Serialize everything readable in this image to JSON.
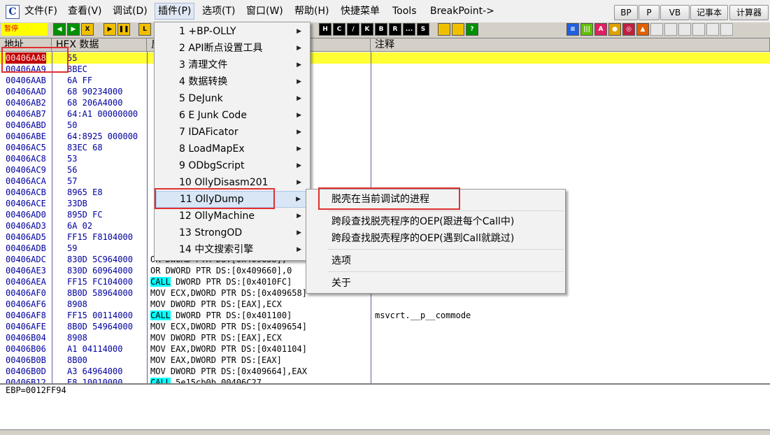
{
  "menubar": {
    "items": [
      "文件(F)",
      "查看(V)",
      "调试(D)",
      "插件(P)",
      "选项(T)",
      "窗口(W)",
      "帮助(H)",
      "快捷菜单",
      "Tools",
      "BreakPoint->"
    ],
    "active_index": 3,
    "quick_buttons": [
      "BP",
      "P",
      "VB",
      "记事本",
      "计算器"
    ]
  },
  "toolbar": {
    "status": "暂停",
    "left_buttons": [
      "◀",
      "▶",
      "X",
      "▶",
      "❚❚",
      "L"
    ],
    "letter_buttons": [
      "H",
      "C",
      "/",
      "K",
      "B",
      "R",
      "...",
      "S"
    ],
    "right_buttons": [
      "≡",
      "|||",
      "A",
      "●",
      "◎",
      "▲"
    ]
  },
  "columns": {
    "addr": "地址",
    "hex": "HEX 数据",
    "dis": "反汇编",
    "comment": "注释"
  },
  "rows": [
    {
      "addr": "00406AA8",
      "hex": "55",
      "dis": "",
      "com": ""
    },
    {
      "addr": "00406AA9",
      "hex": "8BEC",
      "dis": "",
      "com": ""
    },
    {
      "addr": "00406AAB",
      "hex": "6A FF",
      "dis": "",
      "com": ""
    },
    {
      "addr": "00406AAD",
      "hex": "68 90234000",
      "dis": "",
      "com": ""
    },
    {
      "addr": "00406AB2",
      "hex": "68 206A4000",
      "dis": "",
      "com": ""
    },
    {
      "addr": "00406AB7",
      "hex": "64:A1 00000000",
      "dis": "",
      "com": ""
    },
    {
      "addr": "00406ABD",
      "hex": "50",
      "dis": "",
      "com": ""
    },
    {
      "addr": "00406ABE",
      "hex": "64:8925 000000",
      "dis": "",
      "com": ""
    },
    {
      "addr": "00406AC5",
      "hex": "83EC 68",
      "dis": "",
      "com": ""
    },
    {
      "addr": "00406AC8",
      "hex": "53",
      "dis": "",
      "com": ""
    },
    {
      "addr": "00406AC9",
      "hex": "56",
      "dis": "",
      "com": ""
    },
    {
      "addr": "00406ACA",
      "hex": "57",
      "dis": "",
      "com": ""
    },
    {
      "addr": "00406ACB",
      "hex": "8965 E8",
      "dis": "",
      "com": ""
    },
    {
      "addr": "00406ACE",
      "hex": "33DB",
      "dis": "",
      "com": ""
    },
    {
      "addr": "00406AD0",
      "hex": "895D FC",
      "dis": "",
      "com": ""
    },
    {
      "addr": "00406AD3",
      "hex": "6A 02",
      "dis": "",
      "com": ""
    },
    {
      "addr": "00406AD5",
      "hex": "FF15 F8104000",
      "dis": "",
      "com": ""
    },
    {
      "addr": "00406ADB",
      "hex": "59",
      "dis": "",
      "com": ""
    },
    {
      "addr": "00406ADC",
      "hex": "830D 5C964000",
      "dis": "OR DWORD PTR DS:[0x409658],",
      "com": ""
    },
    {
      "addr": "00406AE3",
      "hex": "830D 60964000",
      "dis": "OR DWORD PTR DS:[0x409660],0",
      "com": ""
    },
    {
      "addr": "00406AEA",
      "hex": "FF15 FC104000",
      "call": "CALL",
      "dis": " DWORD PTR DS:[0x4010FC]",
      "com": ""
    },
    {
      "addr": "00406AF0",
      "hex": "8B0D 58964000",
      "dis": "MOV ECX,DWORD PTR DS:[0x409658]",
      "com": ""
    },
    {
      "addr": "00406AF6",
      "hex": "8908",
      "dis": "MOV DWORD PTR DS:[EAX],ECX",
      "com": ""
    },
    {
      "addr": "00406AF8",
      "hex": "FF15 00114000",
      "call": "CALL",
      "dis": " DWORD PTR DS:[0x401100]",
      "com": "msvcrt.__p__commode"
    },
    {
      "addr": "00406AFE",
      "hex": "8B0D 54964000",
      "dis": "MOV ECX,DWORD PTR DS:[0x409654]",
      "com": ""
    },
    {
      "addr": "00406B04",
      "hex": "8908",
      "dis": "MOV DWORD PTR DS:[EAX],ECX",
      "com": ""
    },
    {
      "addr": "00406B06",
      "hex": "A1 04114000",
      "dis": "MOV EAX,DWORD PTR DS:[0x401104]",
      "com": ""
    },
    {
      "addr": "00406B0B",
      "hex": "8B00",
      "dis": "MOV EAX,DWORD PTR DS:[EAX]",
      "com": ""
    },
    {
      "addr": "00406B0D",
      "hex": "A3 64964000",
      "dis": "MOV DWORD PTR DS:[0x409664],EAX",
      "com": ""
    },
    {
      "addr": "00406B12",
      "hex": "E8 10010000",
      "call": "CALL",
      "dis": " 5e15cb0b.00406C27",
      "com": ""
    }
  ],
  "info": {
    "text": "EBP=0012FF94"
  },
  "plugin_menu": {
    "items": [
      "1 +BP-OLLY",
      "2 API断点设置工具",
      "3 清理文件",
      "4 数据转换",
      "5 DeJunk",
      "6 E Junk Code",
      "7 IDAFicator",
      "8 LoadMapEx",
      "9 ODbgScript",
      "10 OllyDisasm201",
      "11 OllyDump",
      "12 OllyMachine",
      "13 StrongOD",
      "14 中文搜索引擎"
    ],
    "highlight_index": 10
  },
  "submenu": {
    "items": [
      "脱壳在当前调试的进程",
      "跨段查找脱壳程序的OEP(跟进每个Call中)",
      "跨段查找脱壳程序的OEP(遇到Call就跳过)",
      "选项",
      "关于"
    ]
  },
  "colors": {
    "selected_row": "#ffff33",
    "call_highlight": "#00ffff",
    "annotation_red": "#e03030",
    "address_blue": "#0000a0"
  }
}
